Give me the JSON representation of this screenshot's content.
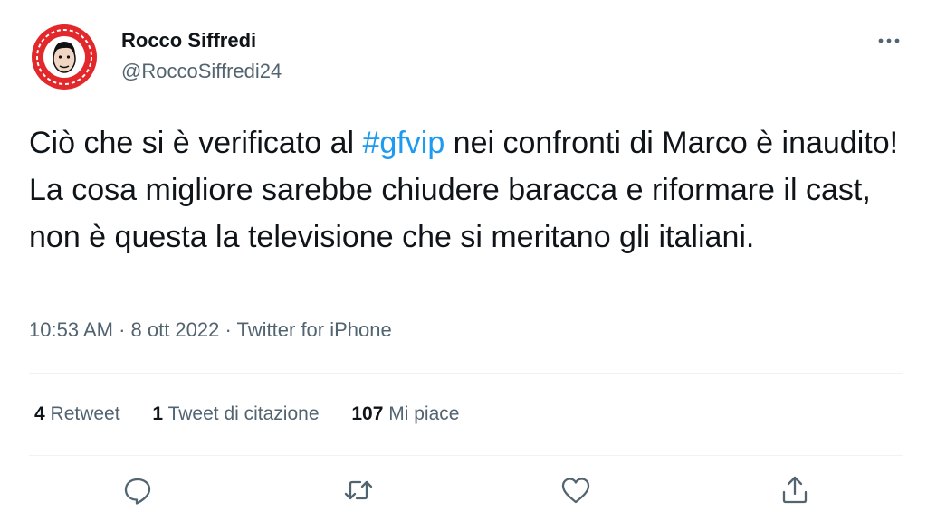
{
  "author": {
    "name": "Rocco Siffredi",
    "handle": "@RoccoSiffredi24"
  },
  "tweet": {
    "text_before": "Ciò che si è verificato al ",
    "hashtag": "#gfvip",
    "text_after": " nei confronti di Marco è inaudito! La cosa migliore sarebbe chiudere baracca e riformare il cast, non è questa la televisione che si meritano gli italiani."
  },
  "meta": {
    "time": "10:53 AM",
    "separator_1": " · ",
    "date": "8 ott 2022",
    "separator_2": " · ",
    "source": "Twitter for iPhone"
  },
  "stats": {
    "retweets": {
      "count": "4",
      "label": "Retweet"
    },
    "quotes": {
      "count": "1",
      "label": "Tweet di citazione"
    },
    "likes": {
      "count": "107",
      "label": "Mi piace"
    }
  },
  "actions": {
    "reply": "reply-icon",
    "retweet": "retweet-icon",
    "like": "heart-icon",
    "share": "share-icon",
    "more": "more-icon"
  },
  "colors": {
    "text": "#0f1419",
    "secondary": "#536471",
    "link": "#1d9bf0",
    "divider": "#eff3f4",
    "avatar_red": "#e3282b"
  }
}
